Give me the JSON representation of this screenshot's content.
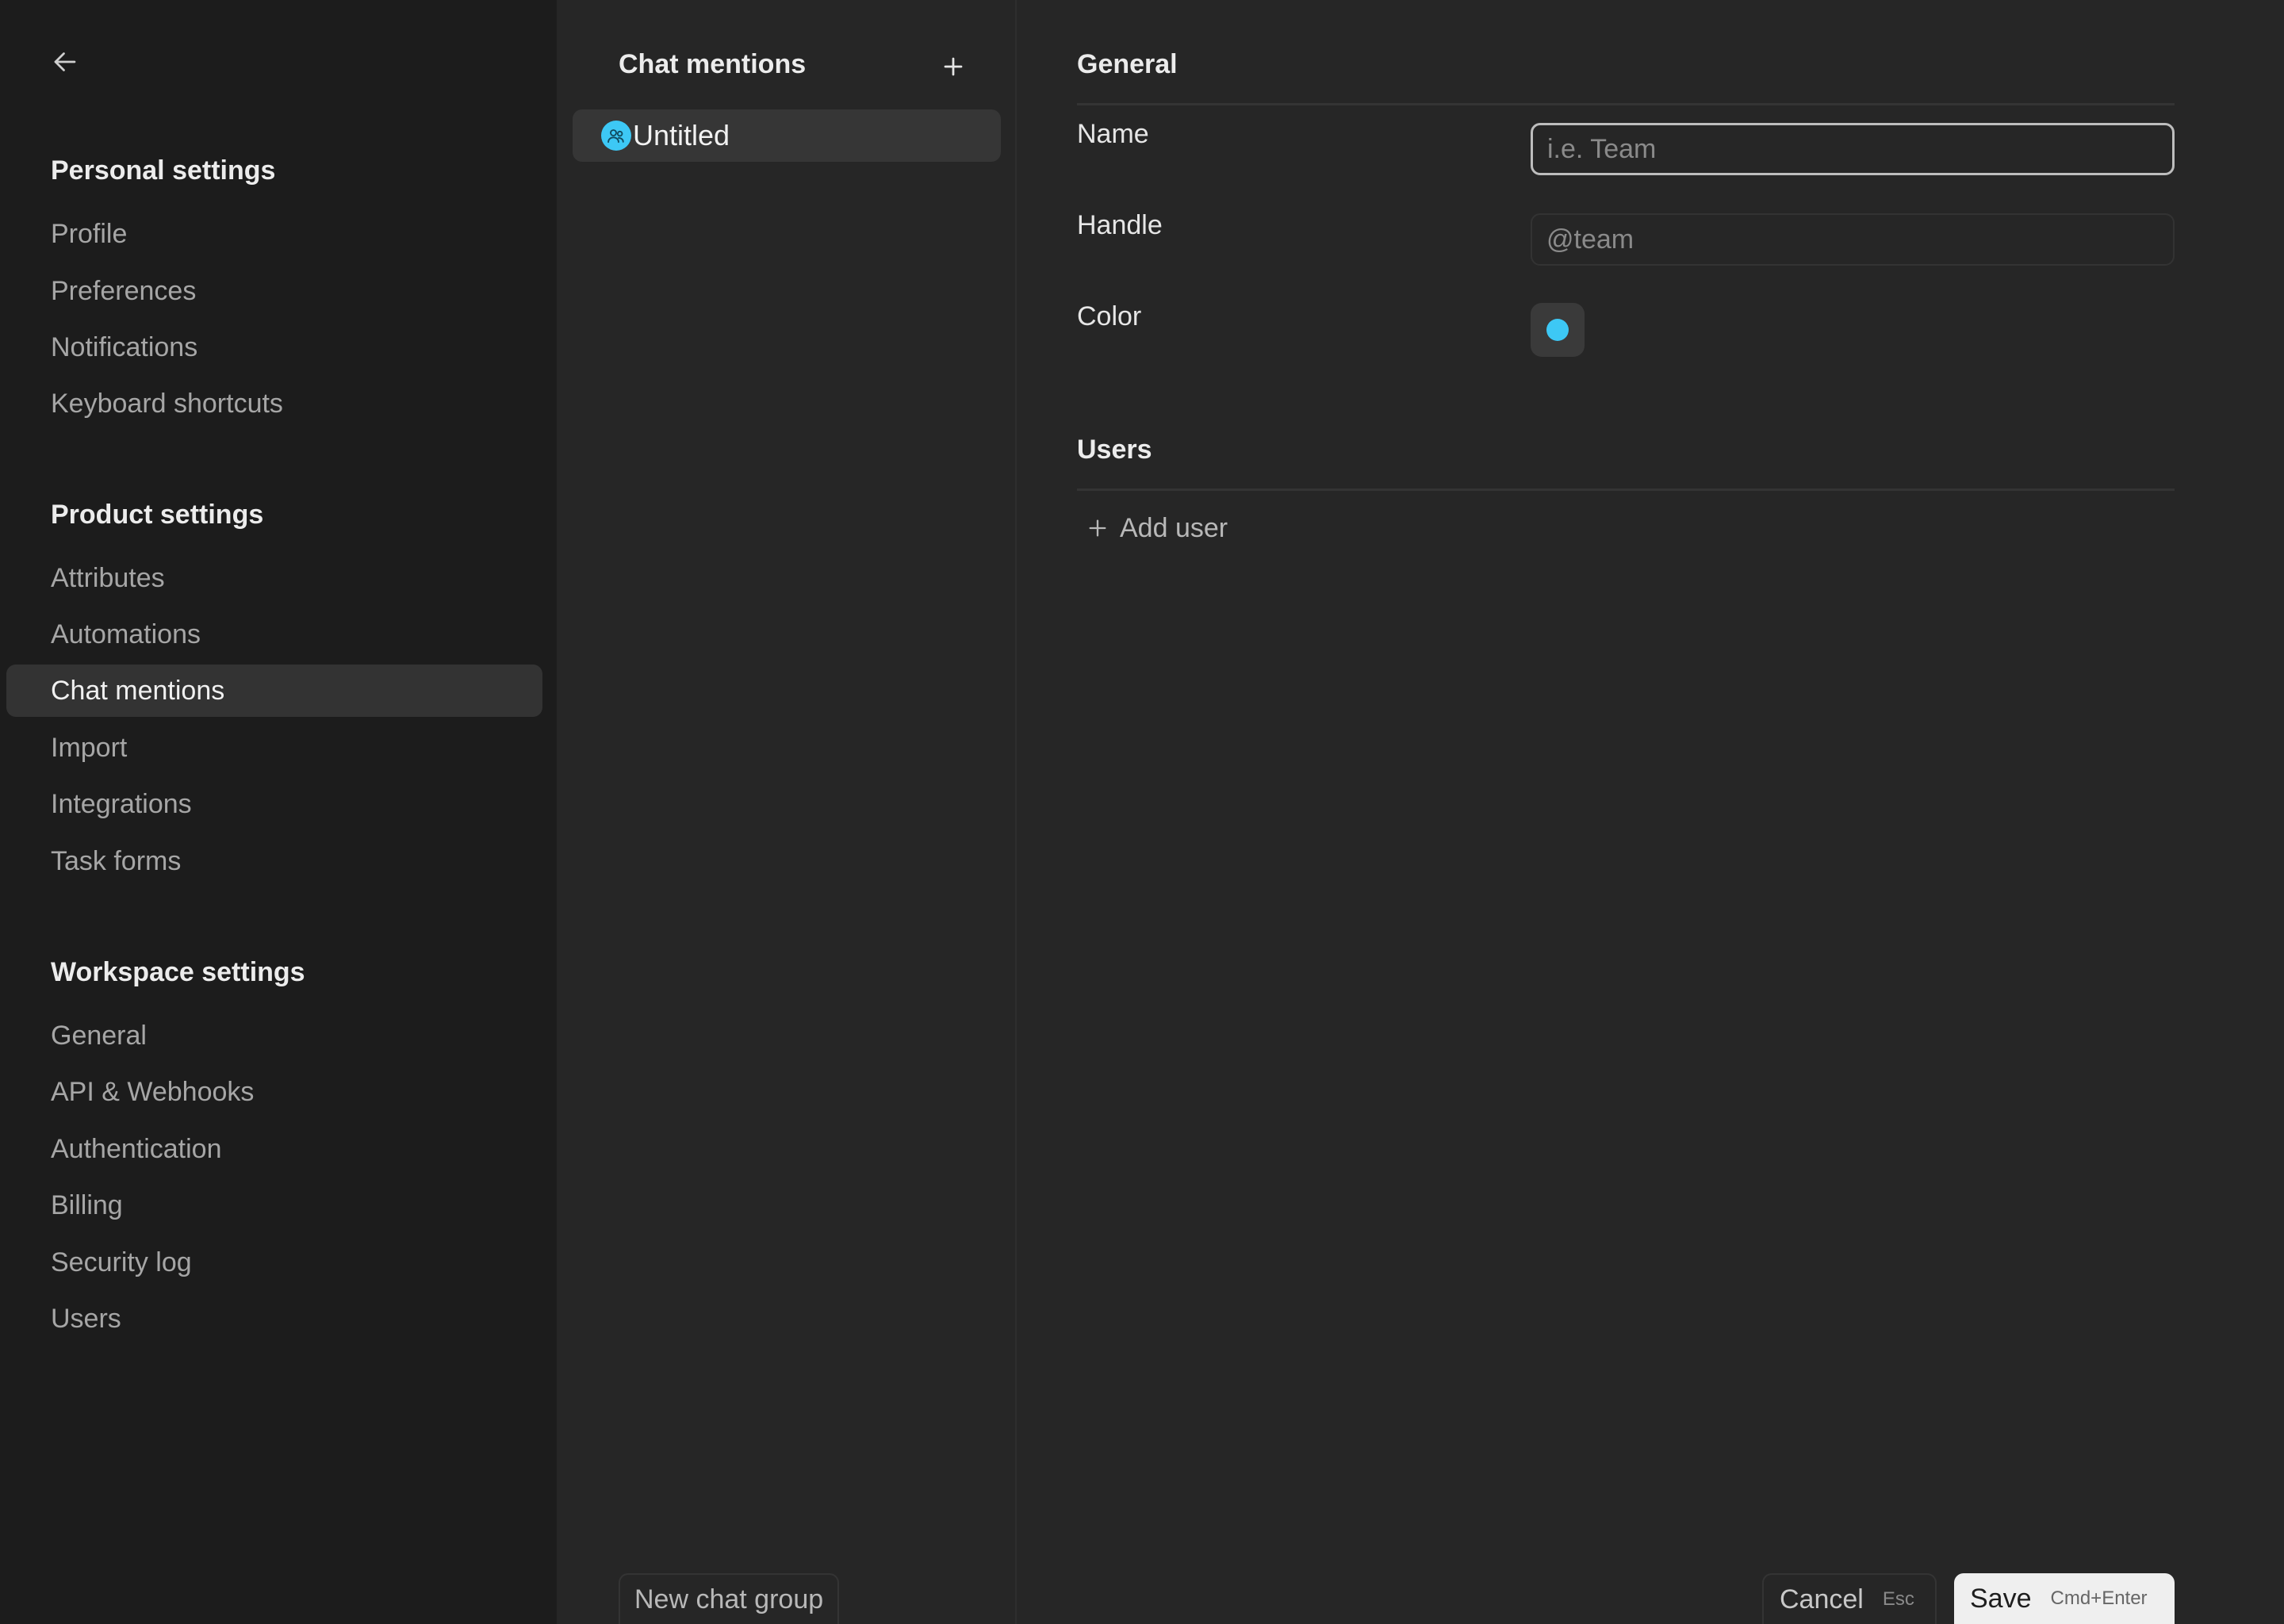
{
  "sidebar": {
    "back_icon": "arrow-left-icon",
    "sections": {
      "personal": {
        "title": "Personal settings",
        "items": [
          "Profile",
          "Preferences",
          "Notifications",
          "Keyboard shortcuts"
        ]
      },
      "product": {
        "title": "Product settings",
        "items": [
          "Attributes",
          "Automations",
          "Chat mentions",
          "Import",
          "Integrations",
          "Task forms"
        ]
      },
      "workspace": {
        "title": "Workspace settings",
        "items": [
          "General",
          "API & Webhooks",
          "Authentication",
          "Billing",
          "Security log",
          "Users"
        ]
      }
    },
    "active_item": "Chat mentions"
  },
  "middle": {
    "title": "Chat mentions",
    "add_icon": "plus-icon",
    "groups": [
      {
        "label": "Untitled",
        "avatar_icon": "group-avatar-icon",
        "avatar_color": "#3dc8f5"
      }
    ],
    "new_group_label": "New chat group"
  },
  "main": {
    "general": {
      "title": "General",
      "name_label": "Name",
      "name_value": "",
      "name_placeholder": "i.e. Team",
      "handle_label": "Handle",
      "handle_value": "",
      "handle_placeholder": "@team",
      "color_label": "Color",
      "color_value": "#3dc8f5"
    },
    "users": {
      "title": "Users",
      "add_user_label": "Add user",
      "add_icon": "plus-icon"
    },
    "footer": {
      "cancel_label": "Cancel",
      "cancel_shortcut": "Esc",
      "save_label": "Save",
      "save_shortcut": "Cmd+Enter"
    }
  }
}
